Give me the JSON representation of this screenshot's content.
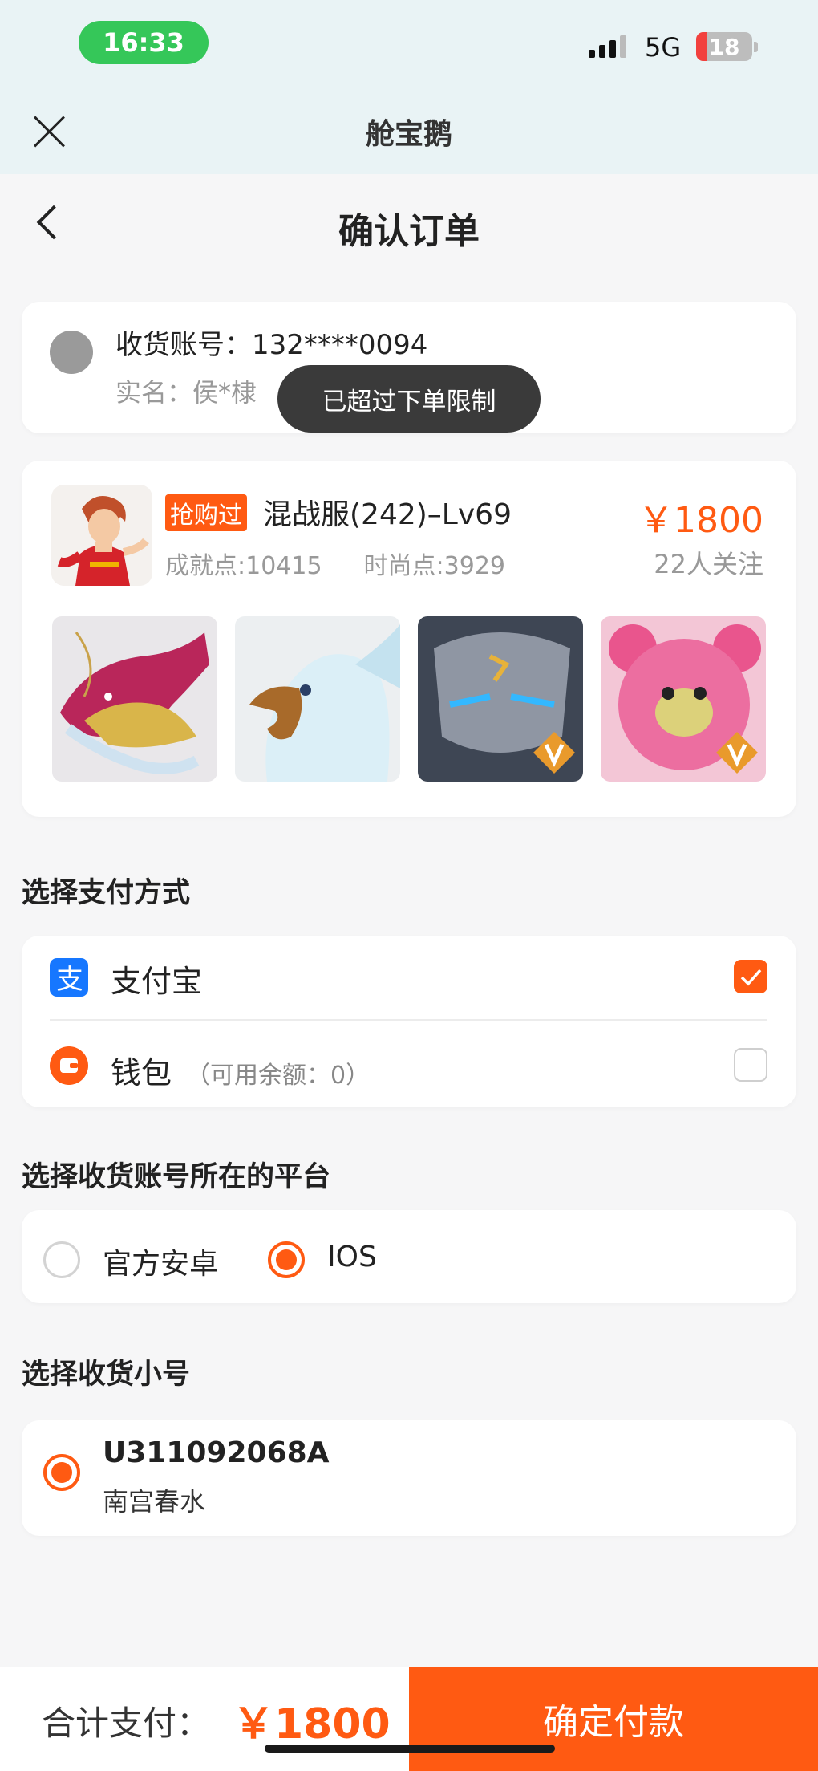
{
  "status_bar": {
    "time": "16:33",
    "network": "5G",
    "battery": "18",
    "battery_level": 0.18
  },
  "app_header": {
    "title": "舱宝鹅"
  },
  "page": {
    "title": "确认订单"
  },
  "account": {
    "account_label": "收货账号：",
    "account_value": "132****0094",
    "name_label": "实名：",
    "name_value": "侯*棣"
  },
  "toast": "已超过下单限制",
  "product": {
    "tag": "抢购过",
    "title": "混战服(242)–Lv69",
    "price": "￥1800",
    "achievement": "成就点:10415",
    "fashion": "时尚点:3929",
    "followers": "22人关注"
  },
  "payment": {
    "section_title": "选择支付方式",
    "options": [
      {
        "label": "支付宝",
        "icon": "alipay-icon",
        "checked": true
      },
      {
        "label": "钱包",
        "sub": "（可用余额：0）",
        "icon": "wallet-icon",
        "checked": false
      }
    ]
  },
  "platform": {
    "section_title": "选择收货账号所在的平台",
    "options": [
      {
        "label": "官方安卓",
        "selected": false
      },
      {
        "label": "IOS",
        "selected": true
      }
    ]
  },
  "sub_account": {
    "section_title": "选择收货小号",
    "id": "U311092068A",
    "name": "南宫春水",
    "selected": true
  },
  "footer": {
    "total_label": "合计支付：",
    "total_amount": "￥1800",
    "confirm_button": "确定付款"
  },
  "colors": {
    "accent": "#ff5a12",
    "alipay": "#1677ff",
    "status_green": "#35c759"
  }
}
